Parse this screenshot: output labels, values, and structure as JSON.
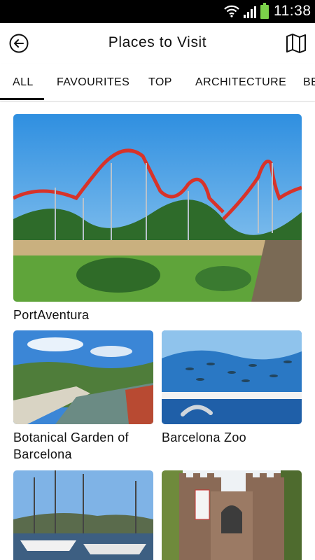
{
  "status_bar": {
    "time": "11:38",
    "icons": [
      "wifi-icon",
      "signal-icon",
      "battery-icon"
    ],
    "battery_color": "#7bd14a"
  },
  "header": {
    "title": "Places to Visit",
    "back_icon": "back-arrow-icon",
    "map_icon": "map-icon"
  },
  "tabs": [
    {
      "label": "ALL",
      "selected": true
    },
    {
      "label": "FAVOURITES",
      "selected": false
    },
    {
      "label": "TOP",
      "selected": false
    },
    {
      "label": "ARCHITECTURE",
      "selected": false
    },
    {
      "label": "BE",
      "selected": false
    }
  ],
  "places": [
    {
      "name": "PortAventura"
    },
    {
      "name": "Botanical Garden of Barcelona"
    },
    {
      "name": "Barcelona Zoo"
    },
    {
      "name": ""
    },
    {
      "name": ""
    }
  ],
  "colors": {
    "accent": "#111111",
    "background": "#ffffff",
    "status_bar": "#000000"
  }
}
